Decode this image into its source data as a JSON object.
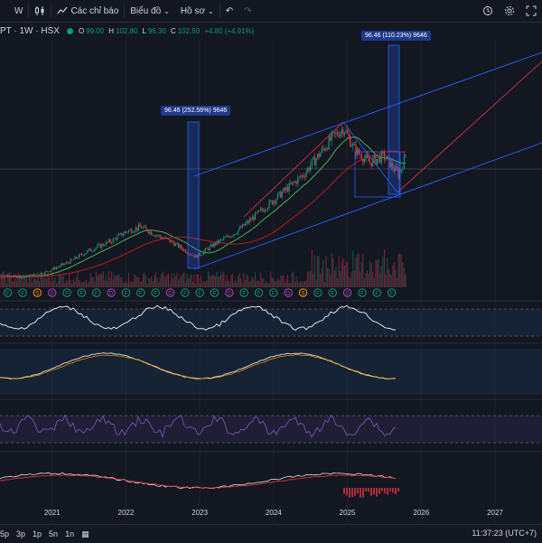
{
  "toolbar": {
    "interval": "W",
    "indicators_label": "Các chỉ báo",
    "chart_type_label": "Biểu đồ",
    "profile_label": "Hồ sơ"
  },
  "symbol": {
    "name": "PT · 1W · HSX",
    "open_label": "O",
    "open": "99.00",
    "high_label": "H",
    "high": "102.80",
    "low_label": "L",
    "low": "96.30",
    "close_label": "C",
    "close": "102.50",
    "change": "+4.80 (+4.91%)"
  },
  "callouts": [
    {
      "text": "96.46 (252.56%) 9646"
    },
    {
      "text": "96.46 (110.23%) 9646"
    }
  ],
  "x_axis": {
    "labels": [
      "2021",
      "2022",
      "2023",
      "2024",
      "2025",
      "2026",
      "2027"
    ]
  },
  "bottom": {
    "ranges": [
      "5p",
      "3p",
      "1p",
      "5n",
      "1n"
    ],
    "time": "11:37:23 (UTC+7)"
  },
  "colors": {
    "background": "#131722",
    "up": "#089981",
    "down": "#f23645",
    "channel": "#2962ff",
    "rsi": "#7e57c2"
  },
  "chart_data": {
    "type": "line",
    "x": [
      2020.0,
      2020.3,
      2020.6,
      2020.9,
      2021.2,
      2021.5,
      2021.8,
      2022.0,
      2022.2,
      2022.4,
      2022.6,
      2022.8,
      2022.95,
      2023.2,
      2023.5,
      2023.8,
      2024.0,
      2024.2,
      2024.4,
      2024.6,
      2024.8,
      2024.95,
      2025.1,
      2025.3,
      2025.5,
      2025.7,
      2025.8
    ],
    "values": [
      22,
      24,
      23,
      26,
      32,
      40,
      46,
      52,
      55,
      50,
      46,
      40,
      36,
      44,
      52,
      64,
      72,
      80,
      88,
      100,
      112,
      118,
      104,
      96,
      100,
      88,
      102.5
    ],
    "title": "",
    "xlabel": "",
    "ylabel": ""
  }
}
